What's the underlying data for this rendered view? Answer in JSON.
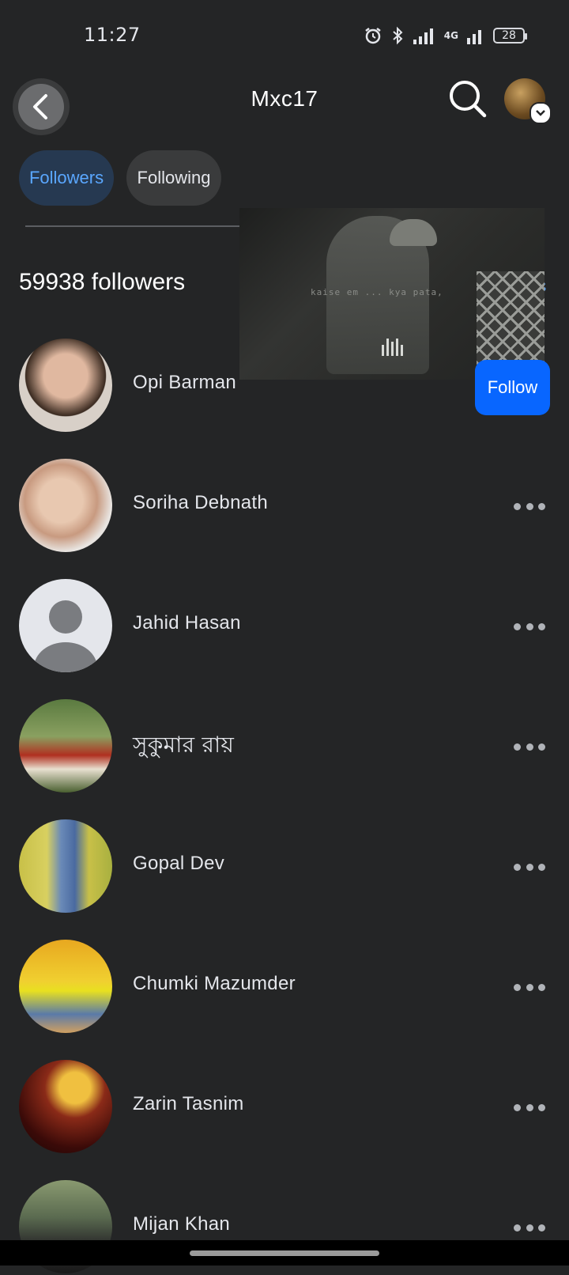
{
  "status_bar": {
    "time": "11:27",
    "network": "4G",
    "battery": "28"
  },
  "header": {
    "title": "Mxc17"
  },
  "tabs": [
    {
      "label": "Followers",
      "active": true
    },
    {
      "label": "Following",
      "active": false
    }
  ],
  "video_overlay": {
    "caption": "kaise em ... kya pata,"
  },
  "followers_count": "59938 followers",
  "count_edge_text": "s",
  "followers": [
    {
      "name": "Opi Barman",
      "action": "Follow",
      "avatar_color": "#c8a898"
    },
    {
      "name": "Soriha Debnath",
      "action": "more",
      "avatar_color": "#d9c8b8"
    },
    {
      "name": "Jahid Hasan",
      "action": "more",
      "avatar_color": "#e4e6eb"
    },
    {
      "name": "সুকুমার রায়",
      "action": "more",
      "avatar_color": "#6a8a4a"
    },
    {
      "name": "Gopal Dev",
      "action": "more",
      "avatar_color": "#c8c048"
    },
    {
      "name": "Chumki Mazumder",
      "action": "more",
      "avatar_color": "#e0b020"
    },
    {
      "name": "Zarin Tasnim",
      "action": "more",
      "avatar_color": "#6a1a10"
    },
    {
      "name": "Mijan Khan",
      "action": "more",
      "avatar_color": "#5a6a50"
    }
  ],
  "colors": {
    "background": "#242526",
    "accent": "#0866ff",
    "tab_active_bg": "#263951",
    "tab_active_text": "#5aa7ff"
  }
}
